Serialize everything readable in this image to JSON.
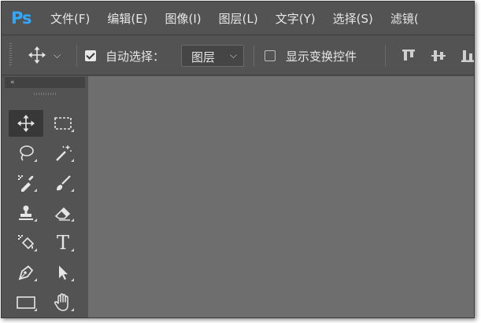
{
  "app": {
    "logo": "Ps"
  },
  "menubar": {
    "items": [
      "文件(F)",
      "编辑(E)",
      "图像(I)",
      "图层(L)",
      "文字(Y)",
      "选择(S)",
      "滤镜("
    ]
  },
  "options": {
    "tool_preset_icon": "move-icon",
    "auto_select_checked": true,
    "auto_select_label": "自动选择：",
    "auto_select_target": "图层",
    "show_transform_checked": false,
    "show_transform_label": "显示变换控件",
    "align_icons": [
      "align-top-edges-icon",
      "align-vertical-centers-icon",
      "align-bottom-edges-icon"
    ]
  },
  "toolbar": {
    "collapse_icon": "«",
    "tools": [
      {
        "name": "move-tool",
        "icon": "move-icon",
        "active": true
      },
      {
        "name": "rectangular-marquee-tool",
        "icon": "marquee-icon"
      },
      {
        "name": "lasso-tool",
        "icon": "lasso-icon"
      },
      {
        "name": "magic-wand-tool",
        "icon": "magic-wand-icon"
      },
      {
        "name": "eyedropper-tool",
        "icon": "eyedropper-icon"
      },
      {
        "name": "brush-tool",
        "icon": "brush-icon"
      },
      {
        "name": "clone-stamp-tool",
        "icon": "stamp-icon"
      },
      {
        "name": "eraser-tool",
        "icon": "eraser-icon"
      },
      {
        "name": "paint-bucket-tool",
        "icon": "paint-bucket-icon"
      },
      {
        "name": "type-tool",
        "icon": "type-icon",
        "glyph": "T"
      },
      {
        "name": "pen-tool",
        "icon": "pen-icon"
      },
      {
        "name": "path-selection-tool",
        "icon": "arrow-icon"
      },
      {
        "name": "rectangle-tool",
        "icon": "rectangle-icon"
      },
      {
        "name": "hand-tool",
        "icon": "hand-icon"
      }
    ]
  },
  "colors": {
    "accent": "#31a8ff",
    "chrome": "#535353",
    "canvas": "#6e6e6e"
  }
}
